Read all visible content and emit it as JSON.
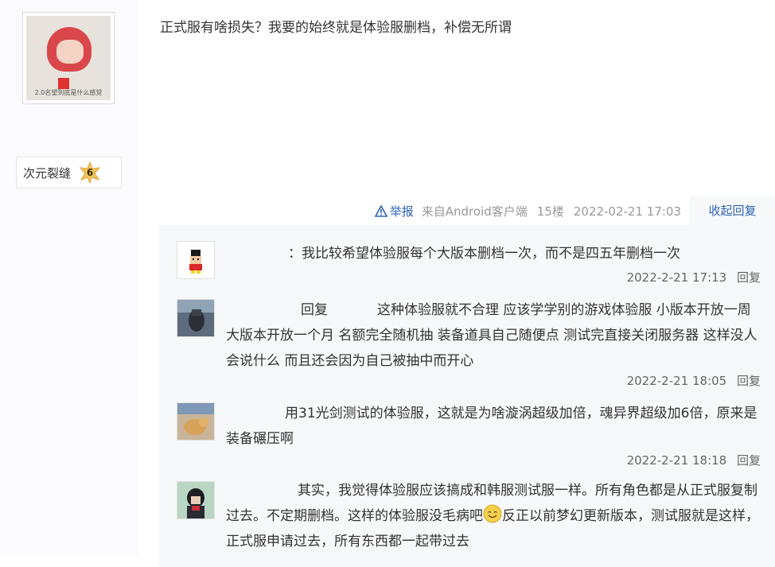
{
  "post": {
    "author": {
      "name": "次元裂缝",
      "level": "6",
      "avatar_caption": "2.0名望到底是什么感觉"
    },
    "content": "正式服有啥损失？我要的始终就是体验服删档，补偿无所谓",
    "tail": {
      "report_label": "举报",
      "source": "来自Android客户端",
      "floor": "15楼",
      "datetime": "2022-02-21 17:03"
    },
    "collapse_label": "收起回复"
  },
  "replies": [
    {
      "text": "：我比较希望体验服每个大版本删档一次，而不是四五年删档一次",
      "time": "2022-2-21 17:13",
      "reply_label": "回复"
    },
    {
      "text_prefix": "回复",
      "text": "这种体验服就不合理 应该学学别的游戏体验服 小版本开放一周 大版本开放一个月 名额完全随机抽 装备道具自己随便点 测试完直接关闭服务器 这样没人会说什么 而且还会因为自己被抽中而开心",
      "time": "2022-2-21 18:05",
      "reply_label": "回复"
    },
    {
      "text": "用31光剑测试的体验服，这就是为啥漩涡超级加倍，魂异界超级加6倍，原来是装备碾压啊",
      "time": "2022-2-21 18:18",
      "reply_label": "回复"
    },
    {
      "text_before": "其实，我觉得体验服应该搞成和韩服测试服一样。所有角色都是从正式服复制过去。不定期删档。这样的体验服没毛病吧",
      "text_after": "反正以前梦幻更新版本，测试服就是这样，正式服申请过去，所有东西都一起带过去"
    }
  ],
  "colors": {
    "link": "#2d64b3",
    "reply_bg": "#f7f8fa",
    "meta": "#999999"
  }
}
